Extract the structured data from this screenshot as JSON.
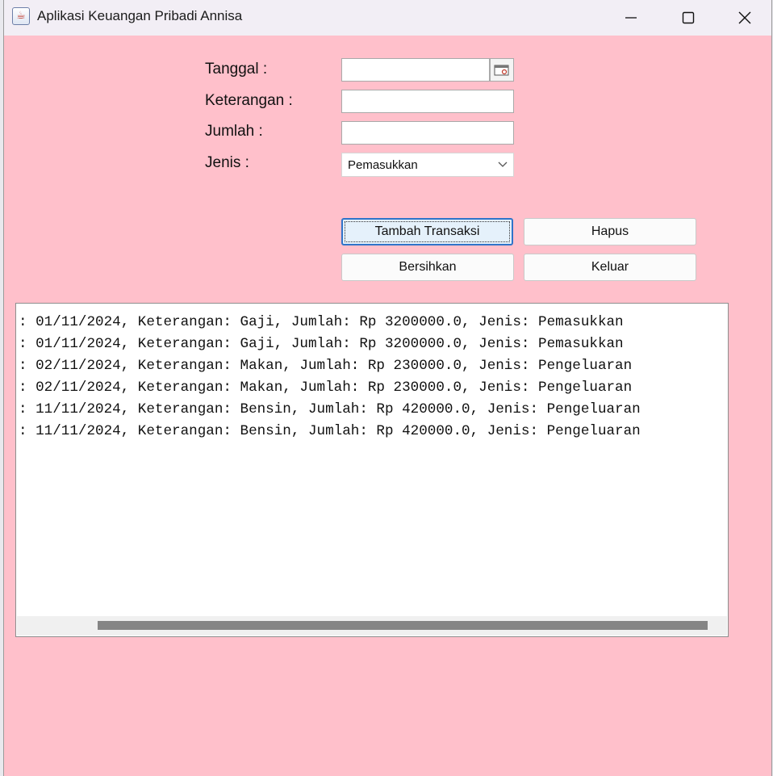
{
  "window": {
    "title": "Aplikasi Keuangan Pribadi Annisa",
    "icon": "java-cup-icon"
  },
  "form": {
    "tanggal_label": "Tanggal :",
    "tanggal_value": "",
    "keterangan_label": "Keterangan :",
    "keterangan_value": "",
    "jumlah_label": "Jumlah :",
    "jumlah_value": "",
    "jenis_label": "Jenis :",
    "jenis_selected": "Pemasukkan"
  },
  "buttons": {
    "tambah": "Tambah Transaksi",
    "hapus": "Hapus",
    "bersihkan": "Bersihkan",
    "keluar": "Keluar"
  },
  "log": {
    "lines": [
      ": 01/11/2024, Keterangan: Gaji, Jumlah: Rp 3200000.0, Jenis: Pemasukkan",
      ": 01/11/2024, Keterangan: Gaji, Jumlah: Rp 3200000.0, Jenis: Pemasukkan",
      ": 02/11/2024, Keterangan: Makan, Jumlah: Rp 230000.0, Jenis: Pengeluaran",
      ": 02/11/2024, Keterangan: Makan, Jumlah: Rp 230000.0, Jenis: Pengeluaran",
      ": 11/11/2024, Keterangan: Bensin, Jumlah: Rp 420000.0, Jenis: Pengeluaran",
      ": 11/11/2024, Keterangan: Bensin, Jumlah: Rp 420000.0, Jenis: Pengeluaran"
    ]
  },
  "colors": {
    "background": "#ffc0cb",
    "titlebar": "#f2eef5",
    "focus_border": "#2f74c9"
  }
}
